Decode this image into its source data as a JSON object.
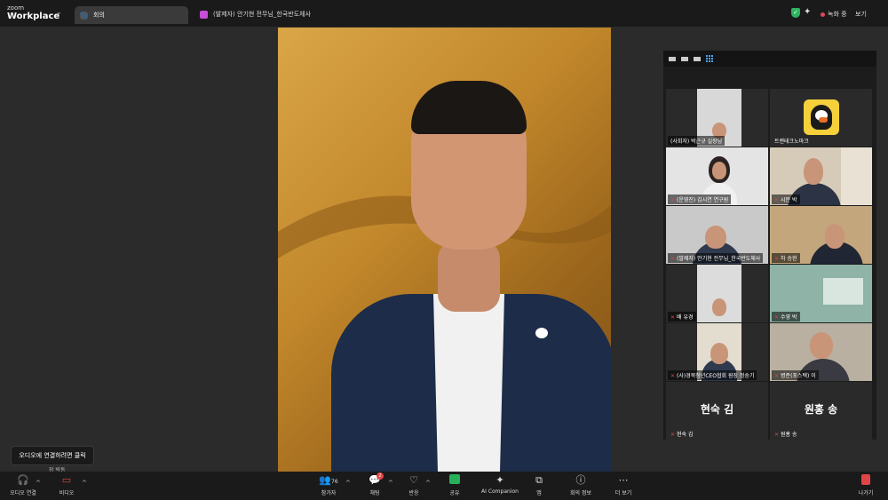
{
  "app": {
    "logo_small": "zoom",
    "logo_big": "Workplace"
  },
  "tab": {
    "label": "회의"
  },
  "meeting": {
    "title": "(발제자) 안기현 전무님_한국반도체사"
  },
  "status": {
    "recording": "녹화 중",
    "view": "보기"
  },
  "gallery": {
    "tiles": [
      {
        "name": "(사회자) 박근규 실장님",
        "muted": false
      },
      {
        "name": "트랜테크노마크",
        "muted": false
      },
      {
        "name": "(운영진) 김시연 연구원",
        "muted": true
      },
      {
        "name": "시문 박",
        "muted": true
      },
      {
        "name": "(발제자) 안기현 전무님_한국반도체사",
        "muted": true
      },
      {
        "name": "하 승현",
        "muted": true
      },
      {
        "name": "배 유경",
        "muted": true
      },
      {
        "name": "수영 박",
        "muted": true
      },
      {
        "name": "(사)경북청년CEO협회 원장 정숭기",
        "muted": true
      },
      {
        "name": "병준(포스텍) 이",
        "muted": true
      },
      {
        "name": "현숙 김",
        "muted": true,
        "big": "현숙 김"
      },
      {
        "name": "원홍 송",
        "muted": true,
        "big": "원홍 송"
      }
    ]
  },
  "tooltip": {
    "text": "오디오에 연결하려면 클릭",
    "sub": "장 박동"
  },
  "toolbar": {
    "audio": "오디오 연결",
    "video": "비디오",
    "participants": "참가자",
    "participants_count": "76",
    "chat": "채팅",
    "chat_badge": "2",
    "reactions": "반응",
    "share": "공유",
    "ai": "AI Companion",
    "apps": "앱",
    "info": "회의 정보",
    "more": "더 보기",
    "leave": "나가기"
  },
  "colors": {
    "share_green": "#26b05a",
    "leave_red": "#e04545",
    "rec_red": "#e0455b"
  },
  "icons": [
    "headphone-icon",
    "video-off-icon",
    "participants-icon",
    "chat-icon",
    "heart-icon",
    "share-icon",
    "sparkle-icon",
    "apps-icon",
    "info-icon",
    "more-icon",
    "leave-icon",
    "shield-icon"
  ]
}
